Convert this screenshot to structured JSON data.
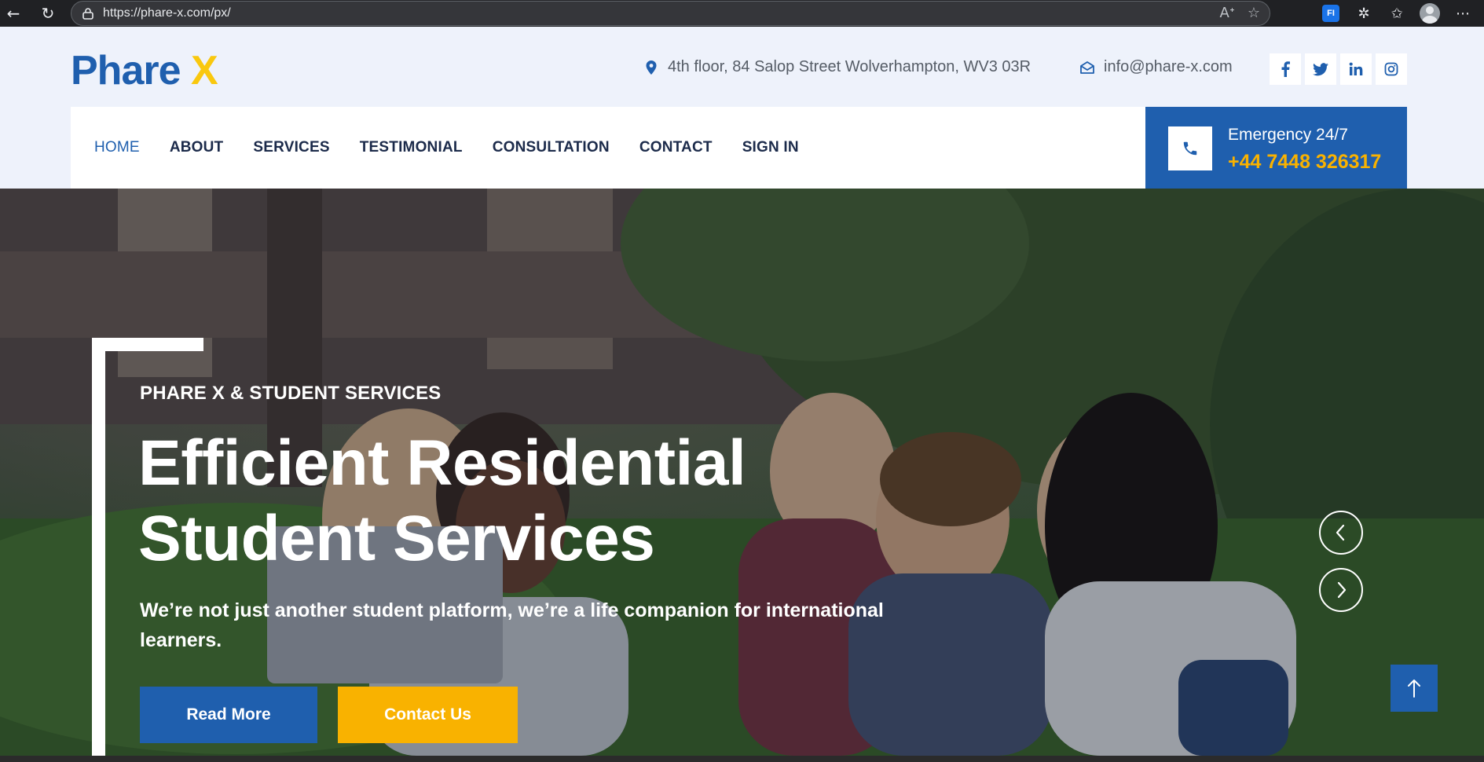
{
  "browser": {
    "url": "https://phare-x.com/px/",
    "extension_label": "FI"
  },
  "header": {
    "logo_part1": "Phare",
    "logo_part2": "X",
    "address": "4th floor, 84 Salop Street Wolverhampton, WV3 03R",
    "email": "info@phare-x.com",
    "socials": [
      {
        "label": "f",
        "icon": "facebook-icon"
      },
      {
        "label": "twitter",
        "icon": "twitter-icon"
      },
      {
        "label": "in",
        "icon": "linkedin-icon"
      },
      {
        "label": "instagram",
        "icon": "instagram-icon"
      }
    ]
  },
  "nav": {
    "items": [
      {
        "label": "HOME",
        "active": true
      },
      {
        "label": "ABOUT"
      },
      {
        "label": "SERVICES"
      },
      {
        "label": "TESTIMONIAL"
      },
      {
        "label": "CONSULTATION"
      },
      {
        "label": "CONTACT"
      },
      {
        "label": "SIGN IN"
      }
    ]
  },
  "emergency": {
    "label": "Emergency 24/7",
    "phone": "+44 7448 326317"
  },
  "hero": {
    "tagline": "PHARE X & STUDENT SERVICES",
    "title_line1": "Efficient Residential",
    "title_line2": "Student Services",
    "description": "We’re not just another student platform, we’re a life companion for international learners.",
    "read_more": "Read More",
    "contact_us": "Contact Us"
  },
  "colors": {
    "brand_blue": "#1f5fae",
    "brand_yellow": "#f9c80e",
    "button_orange": "#f9b200",
    "nav_text": "#1b2a4a"
  }
}
